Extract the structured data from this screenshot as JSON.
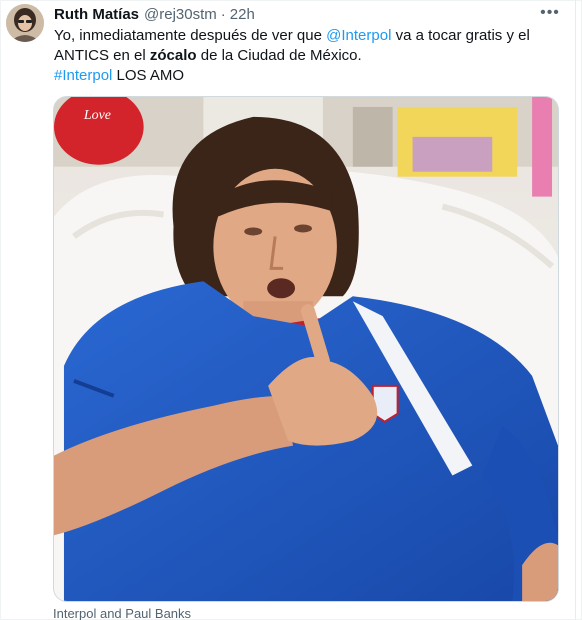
{
  "tweet": {
    "display_name": "Ruth Matías",
    "handle": "@rej30stm",
    "separator": "·",
    "time": "22h",
    "more_icon": "more-horizontal-icon",
    "text": {
      "l1_a": "Yo, inmediatamente después de ver que ",
      "l1_mention": "@Interpol",
      "l1_b": " va a tocar gratis  y el",
      "l2_a": "ANTICS en el ",
      "l2_bold": "zócalo",
      "l2_b": " de la Ciudad de México.",
      "l3_hashtag": "#Interpol",
      "l3_b": " LOS AMO"
    },
    "media_caption": "Interpol and Paul Banks",
    "media_sign_text": "Love"
  },
  "colors": {
    "link": "#1d9bf0",
    "secondary_text": "#536471",
    "jersey": "#1e5cc4"
  }
}
